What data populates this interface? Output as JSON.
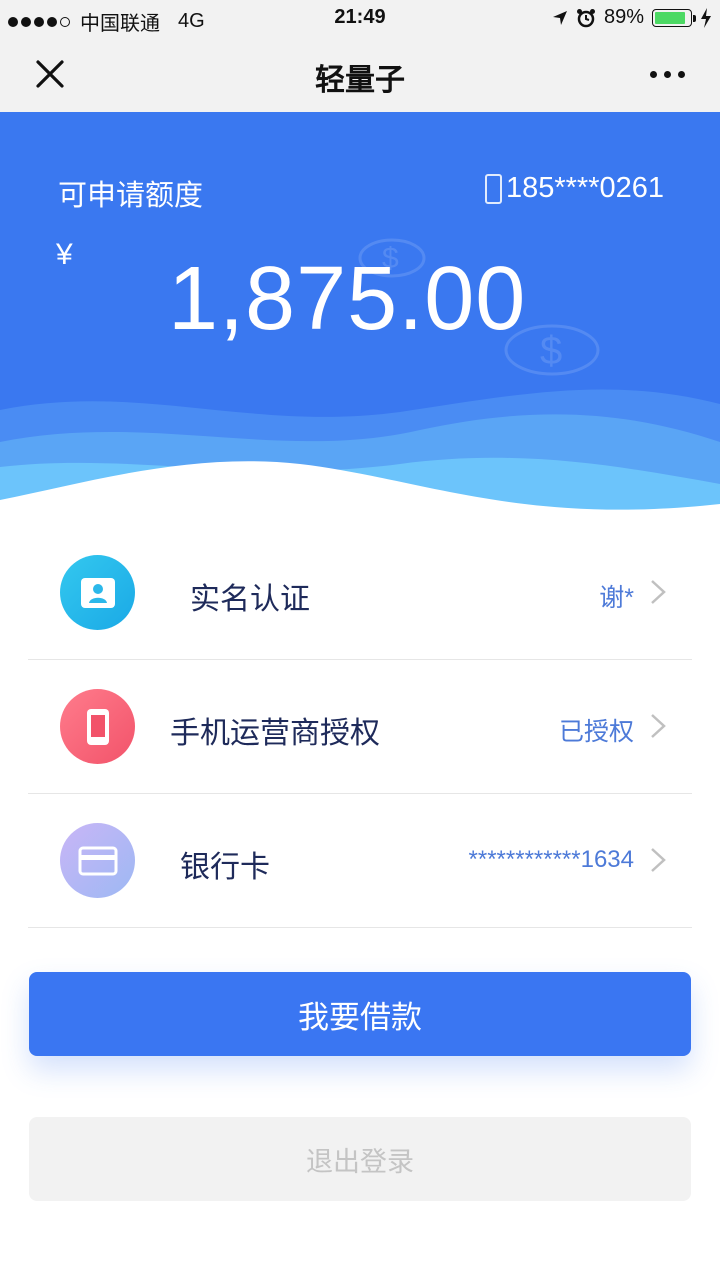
{
  "status_bar": {
    "carrier": "中国联通",
    "network": "4G",
    "time": "21:49",
    "battery": "89%",
    "battery_level": 0.89
  },
  "nav": {
    "title": "轻量子"
  },
  "hero": {
    "label": "可申请额度",
    "phone": "185****0261",
    "currency": "¥",
    "amount": "1,875.00"
  },
  "items": [
    {
      "label": "实名认证",
      "value": "谢*",
      "icon": "id-card-icon"
    },
    {
      "label": "手机运营商授权",
      "value": "已授权",
      "icon": "mobile-phone-icon"
    },
    {
      "label": "银行卡",
      "value": "************1634",
      "icon": "bank-card-icon"
    }
  ],
  "buttons": {
    "borrow": "我要借款",
    "logout": "退出登录"
  },
  "colors": {
    "primary": "#3a76f2",
    "hero_bg": "#3a78f0",
    "label_text": "#1e2a5a",
    "value_text": "#4d7ad8"
  }
}
